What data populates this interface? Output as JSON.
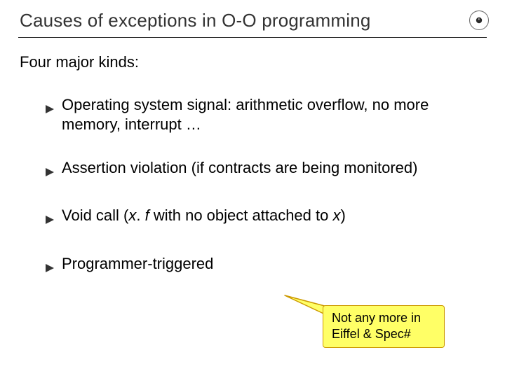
{
  "title": "Causes of exceptions in O-O programming",
  "intro": "Four major kinds:",
  "bullets": [
    {
      "text": "Operating system signal: arithmetic overflow, no more memory, interrupt …"
    },
    {
      "text": "Assertion violation (if contracts are being monitored)"
    },
    {
      "prefix": "Void call (",
      "var1": "x",
      "mid1": ". ",
      "var2": "f",
      "mid2": " with no object attached to ",
      "var3": "x",
      "suffix": ")"
    },
    {
      "text": "Programmer-triggered"
    }
  ],
  "callout": "Not any more in Eiffel & Spec#",
  "icons": {
    "bullet_arrow": "triangle-right"
  }
}
